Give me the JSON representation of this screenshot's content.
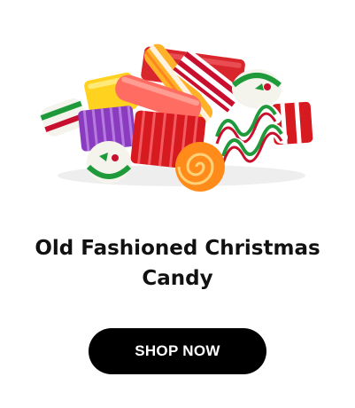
{
  "product": {
    "image_name": "old-fashioned-christmas-candy-photo",
    "title_line1": "Old Fashioned Christmas",
    "title_line2": "Candy"
  },
  "cta": {
    "label": "SHOP NOW",
    "background": "#000000",
    "text_color": "#ffffff"
  }
}
